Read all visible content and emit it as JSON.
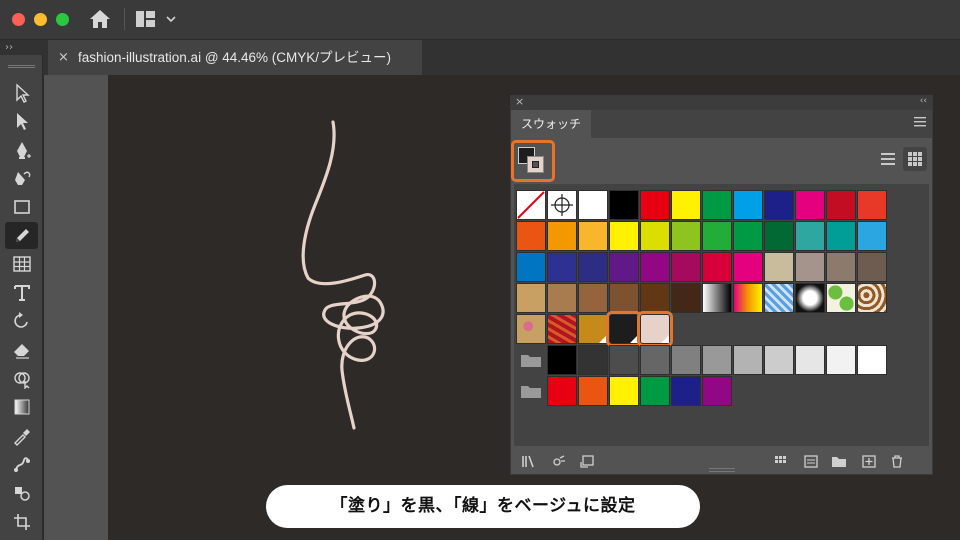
{
  "window": {
    "traffic_lights": {
      "close": "#fe5f57",
      "minimize": "#febc2e",
      "zoom": "#28c840"
    },
    "home_icon": "home-icon",
    "layout_icon": "workspace-layout-icon"
  },
  "document_tab": {
    "close_glyph": "×",
    "title": "fashion-illustration.ai @ 44.46% (CMYK/プレビュー)"
  },
  "toolbar": {
    "collapse_glyph": "››",
    "tools": [
      {
        "name": "selection-tool",
        "icon": "arrow-icon",
        "active": false
      },
      {
        "name": "direct-selection-tool",
        "icon": "direct-arrow-icon",
        "active": false
      },
      {
        "name": "pen-tool",
        "icon": "pen-icon",
        "active": false
      },
      {
        "name": "curvature-tool",
        "icon": "curvature-icon",
        "active": false
      },
      {
        "name": "rectangle-tool",
        "icon": "rectangle-icon",
        "active": false
      },
      {
        "name": "pencil-tool",
        "icon": "pencil-icon",
        "active": true
      },
      {
        "name": "graph-tool",
        "icon": "grid-icon",
        "active": false
      },
      {
        "name": "type-tool",
        "icon": "type-icon",
        "active": false
      },
      {
        "name": "rotate-tool",
        "icon": "rotate-icon",
        "active": false
      },
      {
        "name": "eraser-tool",
        "icon": "eraser-icon",
        "active": false
      },
      {
        "name": "shape-builder-tool",
        "icon": "shape-builder-icon",
        "active": false
      },
      {
        "name": "gradient-tool",
        "icon": "gradient-icon",
        "active": false
      },
      {
        "name": "eyedropper-tool",
        "icon": "eyedropper-icon",
        "active": false
      },
      {
        "name": "puppet-warp-tool",
        "icon": "puppet-icon",
        "active": false
      },
      {
        "name": "symbol-sprayer-tool",
        "icon": "symbol-icon",
        "active": false
      },
      {
        "name": "artboard-tool",
        "icon": "artboard-icon",
        "active": false
      }
    ]
  },
  "canvas": {
    "pasteboard_color": "#535353",
    "artboard_color": "#2d2a27",
    "stroke_color": "#e6d2c8"
  },
  "swatches_panel": {
    "close_glyph": "×",
    "collapse_glyph": "‹‹",
    "tab_label": "スウォッチ",
    "fill_color": "#1d1d1d",
    "stroke_color": "#e6d2c8",
    "highlight_color": "#e5752b",
    "rows": [
      [
        "none",
        "registration",
        "#ffffff",
        "#000000",
        "#e60012",
        "#fff100",
        "#009944",
        "#00a0e9",
        "#1d2088",
        "#e4007f",
        "#c30d23",
        "#e83828"
      ],
      [
        "#ea5514",
        "#f39800",
        "#f8b62d",
        "#fff100",
        "#dadf00",
        "#8fc31f",
        "#22ac38",
        "#009944",
        "#006934",
        "#2ea7a0",
        "#009e96",
        "#2ca6e0"
      ],
      [
        "#0075c2",
        "#2e3192",
        "#2d2e83",
        "#601986",
        "#920783",
        "#a40b5d",
        "#d7003a",
        "#e4007f",
        "#c9bc9c",
        "#a4948b",
        "#8c7b6d",
        "#6e5c51"
      ],
      [
        "#c8a063",
        "#a87c4f",
        "#96643c",
        "#7c5230",
        "#603813",
        "#432818",
        "gradient-white-black",
        "gradient-orange-yellow",
        "pattern-blue-grid",
        "pattern-radial-dark",
        "pattern-green-leaf",
        "pattern-brown-swirl"
      ],
      [
        "pattern-pink-floral",
        "pattern-red-floral",
        "#c68a1a",
        "#1d1d1d",
        "#e6d2c8"
      ]
    ],
    "group_grays": [
      "#000000",
      "#333333",
      "#4d4d4d",
      "#666666",
      "#808080",
      "#999999",
      "#b3b3b3",
      "#cccccc",
      "#e6e6e6",
      "#f2f2f2",
      "#ffffff"
    ],
    "group_brights": [
      "#e60012",
      "#ea5514",
      "#fff100",
      "#009944",
      "#1d2088",
      "#920783"
    ],
    "bottom_icons": [
      "swatch-library-icon",
      "show-kinds-icon",
      "place-swatch-icon",
      "color-group-icon",
      "swatch-options-icon",
      "new-folder-icon",
      "new-swatch-icon",
      "trash-icon"
    ]
  },
  "caption": {
    "text": "「塗り」を黒、「線」をベージュに設定"
  }
}
